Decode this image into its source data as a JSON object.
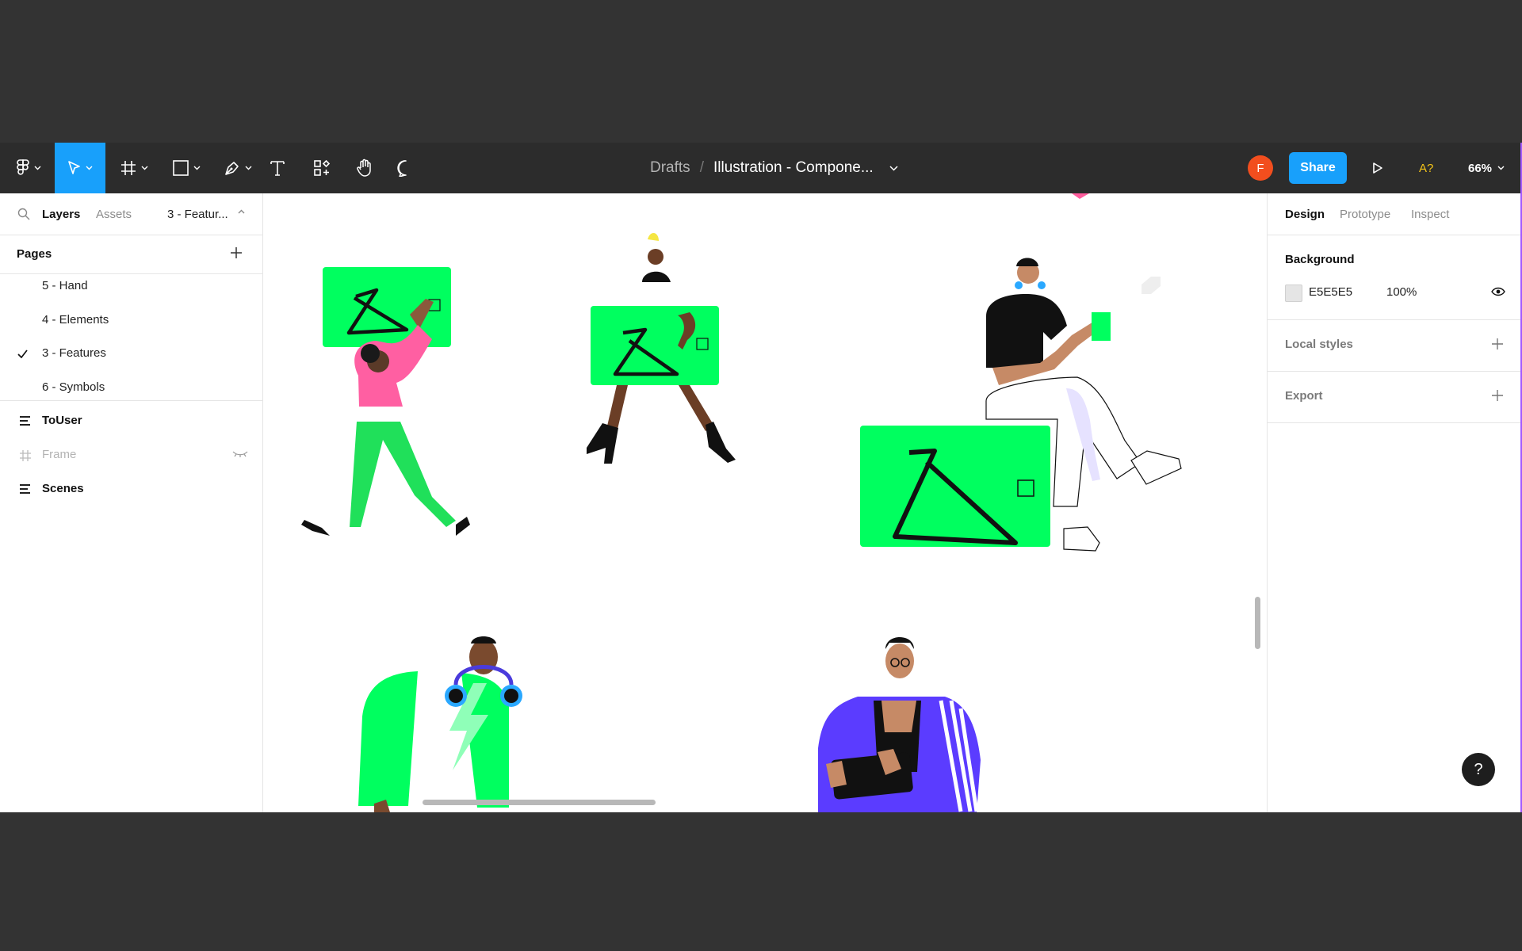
{
  "toolbar": {
    "breadcrumb_root": "Drafts",
    "breadcrumb_sep": "/",
    "file_name": "Illustration - Compone...",
    "avatar_initial": "F",
    "share_label": "Share",
    "ai_label": "A?",
    "zoom": "66%"
  },
  "left_panel": {
    "tabs": {
      "layers": "Layers",
      "assets": "Assets",
      "current_page": "3 - Featur..."
    },
    "pages_title": "Pages",
    "pages": [
      {
        "label": "5 - Hand",
        "selected": false
      },
      {
        "label": "4 - Elements",
        "selected": false
      },
      {
        "label": "3 - Features",
        "selected": true
      },
      {
        "label": "6 - Symbols",
        "selected": false
      }
    ],
    "layers": [
      {
        "label": "ToUser",
        "icon": "component-list-icon",
        "hidden": false
      },
      {
        "label": "Frame",
        "icon": "frame-icon",
        "hidden": true
      },
      {
        "label": "Scenes",
        "icon": "component-list-icon",
        "hidden": false
      }
    ]
  },
  "right_panel": {
    "tabs": {
      "design": "Design",
      "prototype": "Prototype",
      "inspect": "Inspect"
    },
    "background": {
      "title": "Background",
      "hex": "E5E5E5",
      "opacity": "100%"
    },
    "local_styles": "Local styles",
    "export": "Export"
  },
  "help_label": "?",
  "colors": {
    "accent": "#18a0fb",
    "card_green": "#00ff5f",
    "toolbar_bg": "#2c2c2c",
    "avatar": "#f24e1e"
  }
}
